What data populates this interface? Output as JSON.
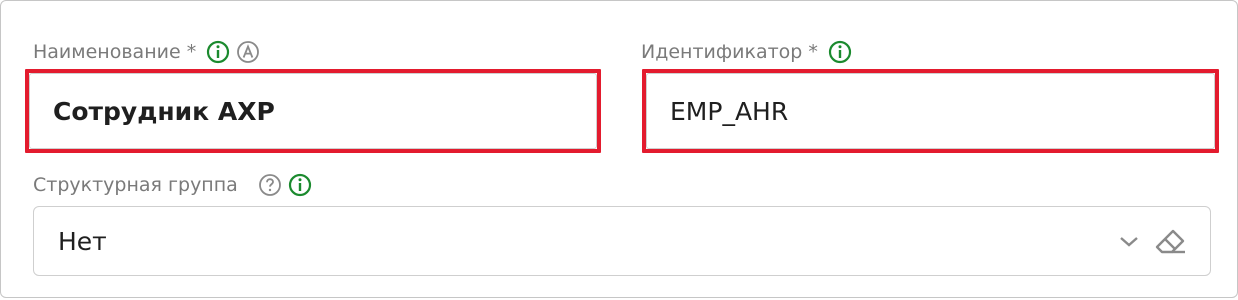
{
  "form": {
    "name_field": {
      "label": "Наименование *",
      "value": "Сотрудник АХР",
      "icons": [
        "info-icon",
        "auto-translate-icon"
      ]
    },
    "id_field": {
      "label": "Идентификатор *",
      "value": "EMP_AHR",
      "icons": [
        "info-icon"
      ]
    },
    "group_field": {
      "label": "Структурная группа",
      "value": "Нет",
      "icons": [
        "help-icon",
        "info-icon"
      ]
    }
  },
  "colors": {
    "error_border": "#e31b2e",
    "info_green": "#1b8a2e",
    "label_gray": "#7a7a7a",
    "icon_gray": "#8a8a8a"
  }
}
